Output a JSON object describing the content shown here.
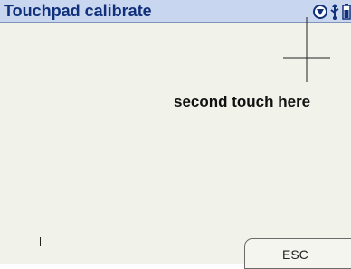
{
  "window": {
    "title": "Touchpad calibrate"
  },
  "status_icons": [
    "nav-down-circle-icon",
    "usb-icon",
    "battery-icon"
  ],
  "calibration": {
    "prompt": "second touch here"
  },
  "softkeys": {
    "esc_label": "ESC"
  },
  "colors": {
    "titlebar_bg": "#c8d7ef",
    "title_text": "#10307c",
    "screen_bg": "#f1f3ea"
  }
}
